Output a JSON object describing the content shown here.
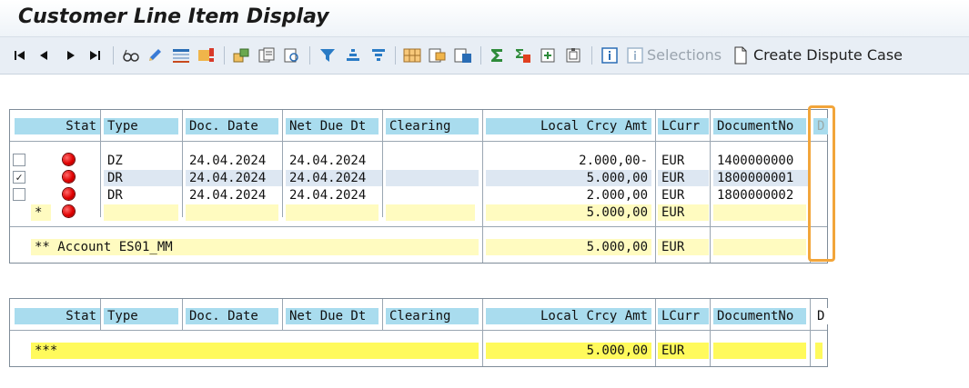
{
  "window": {
    "title": "Customer Line Item Display"
  },
  "toolbar": {
    "icons": [
      "first-page-icon",
      "previous-page-icon",
      "next-page-icon",
      "last-page-icon",
      "glasses-icon",
      "pencil-icon",
      "select-all-icon",
      "deselect-icon",
      "mass-change-icon",
      "copy-icon",
      "detail-icon",
      "filter-icon",
      "sort-ascending-icon",
      "sort-descending-icon",
      "layout-icon",
      "change-layout-icon",
      "save-layout-icon",
      "sum-icon",
      "subtotal-icon",
      "export-icon",
      "import-icon",
      "info-icon",
      "selections-info-icon",
      "document-icon"
    ],
    "selections_label": "Selections",
    "dispute_label": "Create Dispute Case"
  },
  "table1": {
    "headers": {
      "stat": "Stat",
      "type": "Type",
      "doc_date": "Doc. Date",
      "net_due": "Net Due Dt",
      "clearing": "Clearing",
      "amount": "Local Crcy Amt",
      "lcurr": "LCurr",
      "docno": "DocumentNo",
      "d": "D"
    },
    "rows": [
      {
        "checked": false,
        "type": "DZ",
        "doc_date": "24.04.2024",
        "net_due": "24.04.2024",
        "clearing": "",
        "amount": "2.000,00-",
        "lcurr": "EUR",
        "docno": "1400000000"
      },
      {
        "checked": true,
        "type": "DR",
        "doc_date": "24.04.2024",
        "net_due": "24.04.2024",
        "clearing": "",
        "amount": "5.000,00",
        "lcurr": "EUR",
        "docno": "1800000001"
      },
      {
        "checked": false,
        "type": "DR",
        "doc_date": "24.04.2024",
        "net_due": "24.04.2024",
        "clearing": "",
        "amount": "2.000,00",
        "lcurr": "EUR",
        "docno": "1800000002"
      }
    ],
    "subtotal": {
      "marker": "*",
      "amount": "5.000,00",
      "lcurr": "EUR"
    },
    "account_total": {
      "label": "** Account ES01_MM",
      "amount": "5.000,00",
      "lcurr": "EUR"
    },
    "checkmark": "✓"
  },
  "table2": {
    "headers": {
      "stat": "Stat",
      "type": "Type",
      "doc_date": "Doc. Date",
      "net_due": "Net Due Dt",
      "clearing": "Clearing",
      "amount": "Local Crcy Amt",
      "lcurr": "LCurr",
      "docno": "DocumentNo",
      "d": "D"
    },
    "grand_total": {
      "label": "***",
      "amount": "5.000,00",
      "lcurr": "EUR"
    }
  },
  "colors": {
    "header": "#a9dcee",
    "subtotal": "#fffbc0",
    "grand_total": "#fffa5c",
    "highlight": "#f2a53a",
    "status_light": "#e00000"
  }
}
